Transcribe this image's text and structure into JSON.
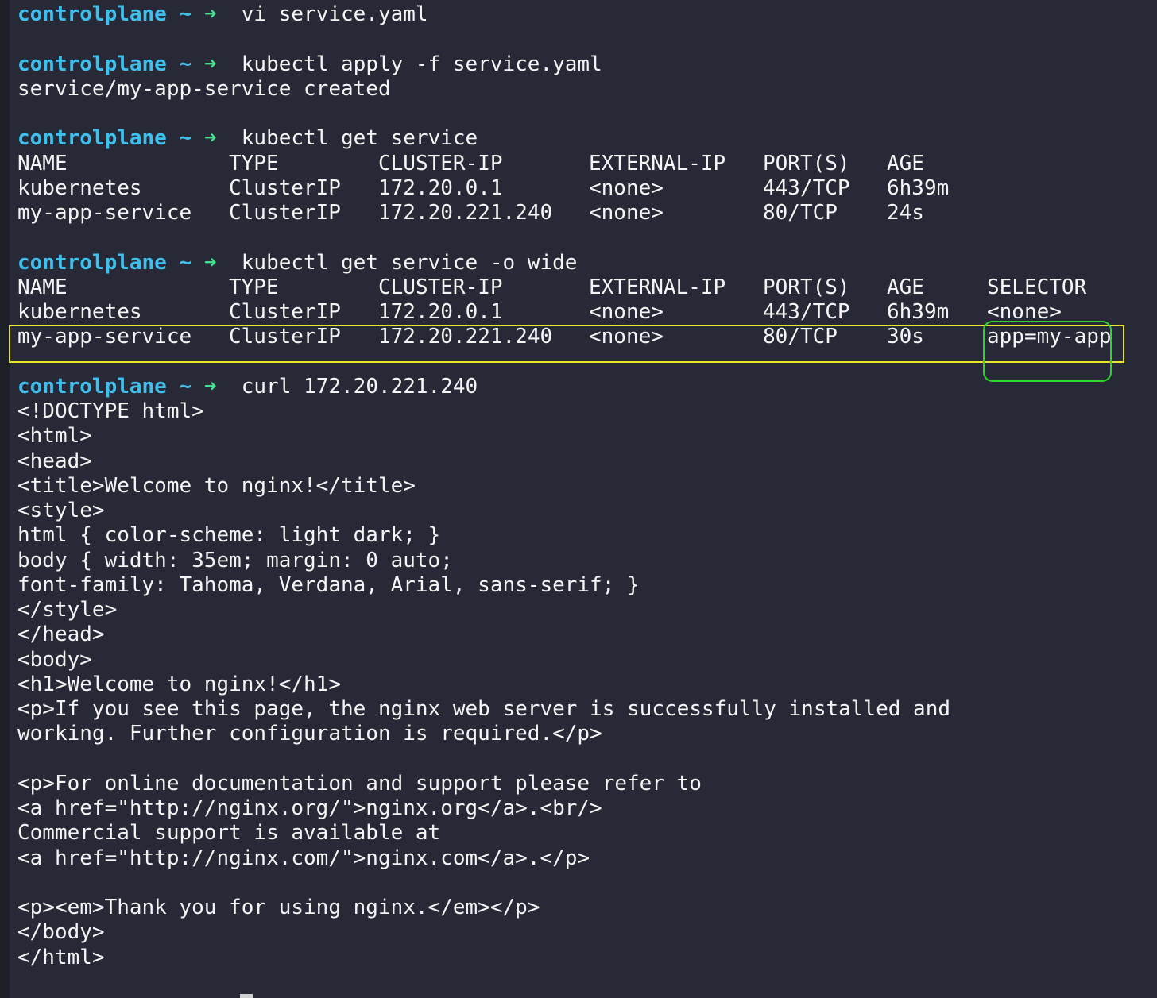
{
  "prompt": {
    "host": "controlplane",
    "tilde": "~",
    "arrow": "➜"
  },
  "commands": {
    "vi": "vi service.yaml",
    "apply": "kubectl apply -f service.yaml",
    "get_service": "kubectl get service",
    "get_service_wide": "kubectl get service -o wide",
    "curl": "curl 172.20.221.240"
  },
  "apply_output": "service/my-app-service created",
  "table_headers": [
    "NAME",
    "TYPE",
    "CLUSTER-IP",
    "EXTERNAL-IP",
    "PORT(S)",
    "AGE",
    "SELECTOR"
  ],
  "service_table": {
    "rows": [
      [
        "kubernetes",
        "ClusterIP",
        "172.20.0.1",
        "<none>",
        "443/TCP",
        "6h39m"
      ],
      [
        "my-app-service",
        "ClusterIP",
        "172.20.221.240",
        "<none>",
        "80/TCP",
        "24s"
      ]
    ]
  },
  "service_table_wide": {
    "rows": [
      [
        "kubernetes",
        "ClusterIP",
        "172.20.0.1",
        "<none>",
        "443/TCP",
        "6h39m",
        "<none>"
      ],
      [
        "my-app-service",
        "ClusterIP",
        "172.20.221.240",
        "<none>",
        "80/TCP",
        "30s",
        "app=my-app"
      ]
    ]
  },
  "curl_output": [
    "<!DOCTYPE html>",
    "<html>",
    "<head>",
    "<title>Welcome to nginx!</title>",
    "<style>",
    "html { color-scheme: light dark; }",
    "body { width: 35em; margin: 0 auto;",
    "font-family: Tahoma, Verdana, Arial, sans-serif; }",
    "</style>",
    "</head>",
    "<body>",
    "<h1>Welcome to nginx!</h1>",
    "<p>If you see this page, the nginx web server is successfully installed and",
    "working. Further configuration is required.</p>",
    "",
    "<p>For online documentation and support please refer to",
    "<a href=\"http://nginx.org/\">nginx.org</a>.<br/>",
    "Commercial support is available at",
    "<a href=\"http://nginx.com/\">nginx.com</a>.</p>",
    "",
    "<p><em>Thank you for using nginx.</em></p>",
    "</body>",
    "</html>"
  ],
  "colors": {
    "background": "#272a36",
    "prompt_host": "#3ec0ef",
    "prompt_arrow": "#41e28b",
    "text": "#f4f4f4",
    "highlight_row_border": "#e8e42a",
    "highlight_selector_border": "#2ed52b"
  }
}
